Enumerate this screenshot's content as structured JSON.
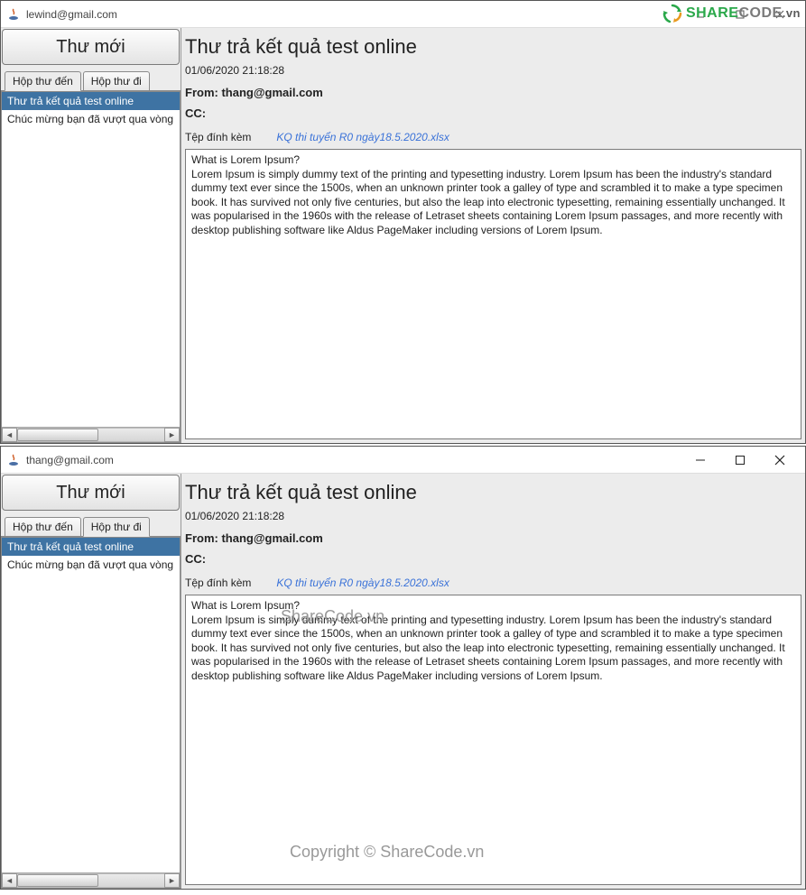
{
  "watermark": {
    "brand_share": "SHARE",
    "brand_code": "CODE",
    "brand_tld": ".vn",
    "center_text": "ShareCode.vn",
    "bottom_text": "Copyright © ShareCode.vn"
  },
  "compose_label": "Thư mới",
  "tabs": {
    "inbox": "Hộp thư đến",
    "sent": "Hộp thư đi"
  },
  "mails": [
    {
      "subject": "Thư trả kết quả test online"
    },
    {
      "subject": "Chúc mừng bạn đã vượt qua vòng"
    }
  ],
  "detail": {
    "subject": "Thư trả kết quả test online",
    "timestamp": "01/06/2020 21:18:28",
    "from_label": "From: ",
    "from_value": "thang@gmail.com",
    "cc_label": "CC:",
    "attach_label": "Tệp đính kèm",
    "attach_file": "KQ thi tuyển R0 ngày18.5.2020.xlsx",
    "body": "What is Lorem Ipsum?\nLorem Ipsum is simply dummy text of the printing and typesetting industry. Lorem Ipsum has been the industry's standard dummy text ever since the 1500s, when an unknown printer took a galley of type and scrambled it to make a type specimen book. It has survived not only five centuries, but also the leap into electronic typesetting, remaining essentially unchanged. It was popularised in the 1960s with the release of Letraset sheets containing Lorem Ipsum passages, and more recently with desktop publishing software like Aldus PageMaker including versions of Lorem Ipsum."
  },
  "windows": [
    {
      "title": "lewind@gmail.com",
      "active_tab": "inbox",
      "controls_style": "swing"
    },
    {
      "title": "thang@gmail.com",
      "active_tab": "sent",
      "controls_style": "win10"
    }
  ]
}
